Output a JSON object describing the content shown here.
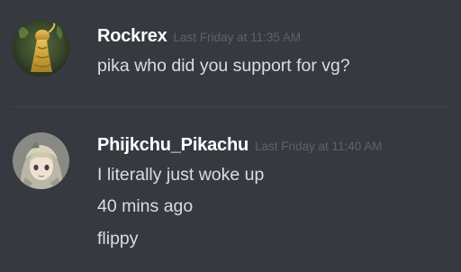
{
  "messages": [
    {
      "username": "Rockrex",
      "timestamp": "Last Friday at 11:35 AM",
      "avatar_icon": "golden-creature-avatar",
      "lines": [
        "pika who did you support for vg?"
      ]
    },
    {
      "username": "Phijkchu_Pikachu",
      "timestamp": "Last Friday at 11:40 AM",
      "avatar_icon": "anime-girl-avatar",
      "lines": [
        "I literally just woke up",
        "40 mins ago",
        "flippy"
      ]
    }
  ],
  "colors": {
    "background": "#36393f",
    "username": "#ffffff",
    "timestamp": "#5f6268",
    "message_text": "#dcddde",
    "divider": "#42454a"
  }
}
